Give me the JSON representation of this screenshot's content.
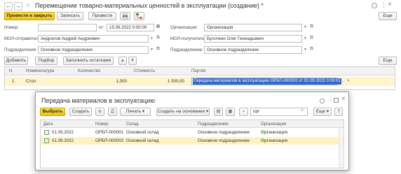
{
  "window": {
    "title": "Перемещение товарно-материальных ценностей в эксплуатации (создание) *",
    "nav_back": "←",
    "nav_forward": "→",
    "star": "☆"
  },
  "toolbar": {
    "post_close": "Провести и закрыть",
    "save": "Записать",
    "post": "Провести",
    "more": "Еще"
  },
  "form": {
    "number_label": "Номер:",
    "number_value": "",
    "date_label": "от:",
    "date_value": "15.09.2022  0:00:00",
    "org_label": "Организация:",
    "org_value": "Организация",
    "sender_label": "МОЛ-отправитель:",
    "sender_value": "Андропов Андрей Андреевич",
    "receiver_label": "МОЛ-получатель:",
    "receiver_value": "Булочкин Олег Геннадьевич",
    "dept_label": "Подразделение:",
    "dept_value": "Основное подразделение",
    "dept2_label": "Подразделение:",
    "dept2_value": "Основное подразделение"
  },
  "table_toolbar": {
    "add": "Добавить",
    "select": "Подбор",
    "fill": "Заполнить остатками",
    "more": "Еще"
  },
  "table": {
    "headers": {
      "n": "N",
      "item": "Номенклатура",
      "qty": "Количество",
      "cost": "Стоимость",
      "batch": "Партия"
    },
    "row": {
      "n": "1",
      "item": "Стол",
      "qty": "1,000",
      "cost": "1 000,00",
      "batch": "Передача материалов в эксплуатацию ОРБП-000002 от 01.09.2022 0:00:01"
    }
  },
  "modal": {
    "title": "Передача материалов в эксплуатацию",
    "choose": "Выбрать",
    "create": "Создать",
    "print": "Печать",
    "create_based": "Создать на основании",
    "search_value": "орг",
    "more": "Еще",
    "help": "?",
    "headers": {
      "date": "Дата",
      "number": "Номер",
      "warehouse": "Склад",
      "dept": "Подразделение",
      "org": "Организация"
    },
    "rows": [
      {
        "date": "01.09.2022",
        "number": "ОРБП-000001",
        "warehouse": "Основной склад",
        "dept": "Основное подразделение",
        "org_highlight": "Орг",
        "org_rest": "анизация"
      },
      {
        "date": "01.09.2022",
        "number": "ОРБП-000002",
        "warehouse": "Основной склад",
        "dept": "Основное подразделение",
        "org_highlight": "Орг",
        "org_rest": "анизация"
      }
    ]
  },
  "colors": {
    "primary_button": "#f2c40f",
    "selection_blue": "#3469c8",
    "row_selected": "#fff2c2",
    "highlight_green": "#2c8a2c"
  }
}
